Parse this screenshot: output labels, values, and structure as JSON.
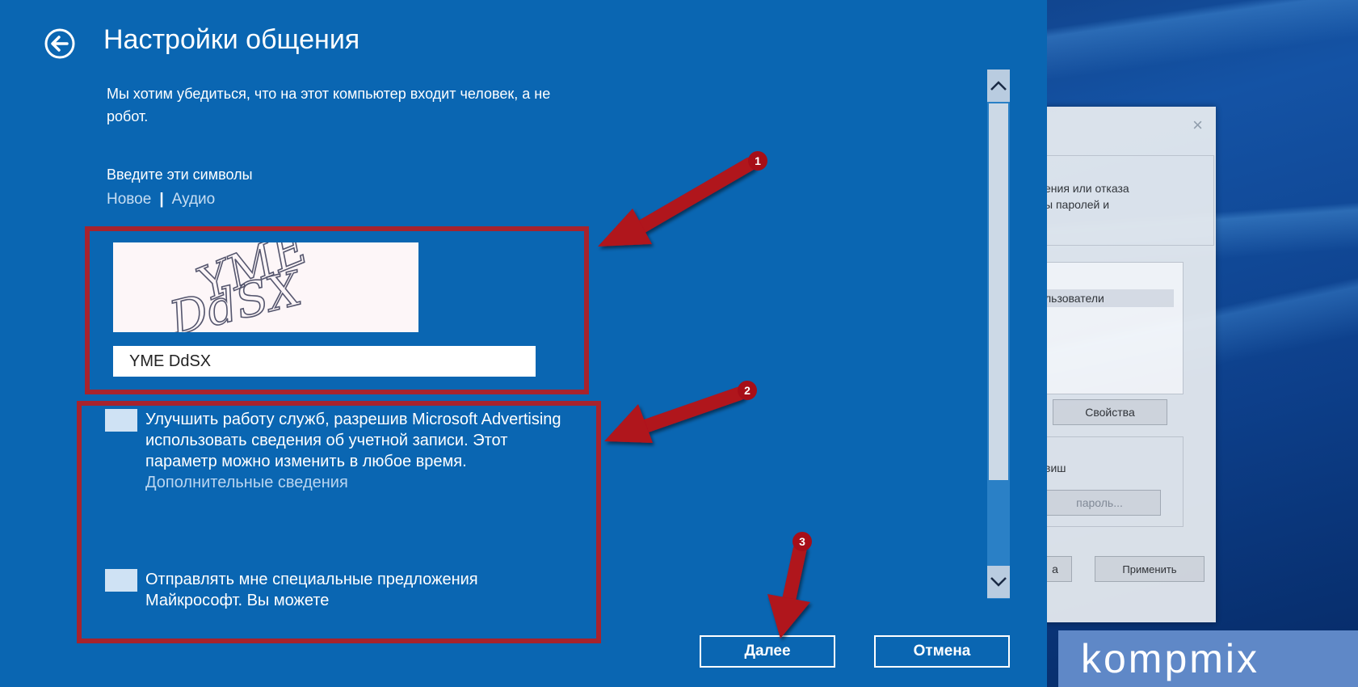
{
  "dialog": {
    "title": "Настройки общения",
    "intro": "Мы хотим убедиться, что на этот компьютер входит человек, а не робот.",
    "prompt": "Введите эти символы",
    "links": {
      "new": "Новое",
      "audio": "Аудио"
    },
    "captcha": {
      "image_text_line1": "YME",
      "image_text_line2": "DdSX",
      "input_value": "YME DdSX"
    },
    "options": [
      {
        "text": "Улучшить работу служб, разрешив Microsoft Advertising использовать сведения об учетной записи. Этот параметр можно изменить в любое время.",
        "link": "Дополнительные сведения"
      },
      {
        "text": "Отправлять мне специальные предложения Майкрософт. Вы можете"
      }
    ],
    "buttons": {
      "next": "Далее",
      "cancel": "Отмена"
    }
  },
  "background_dialog": {
    "close": "×",
    "text_line1": "ения или отказа",
    "text_line2": "ы паролей и",
    "list_item": "льзователи",
    "properties_button": "Свойства",
    "label": "виш",
    "password_button": "пароль...",
    "partial_button": "а",
    "apply_button": "Применить"
  },
  "annotations": {
    "badge1": "1",
    "badge2": "2",
    "badge3": "3"
  },
  "watermark": "kompmix",
  "colors": {
    "panel": "#0a66b2",
    "annotation": "#a7232d"
  }
}
